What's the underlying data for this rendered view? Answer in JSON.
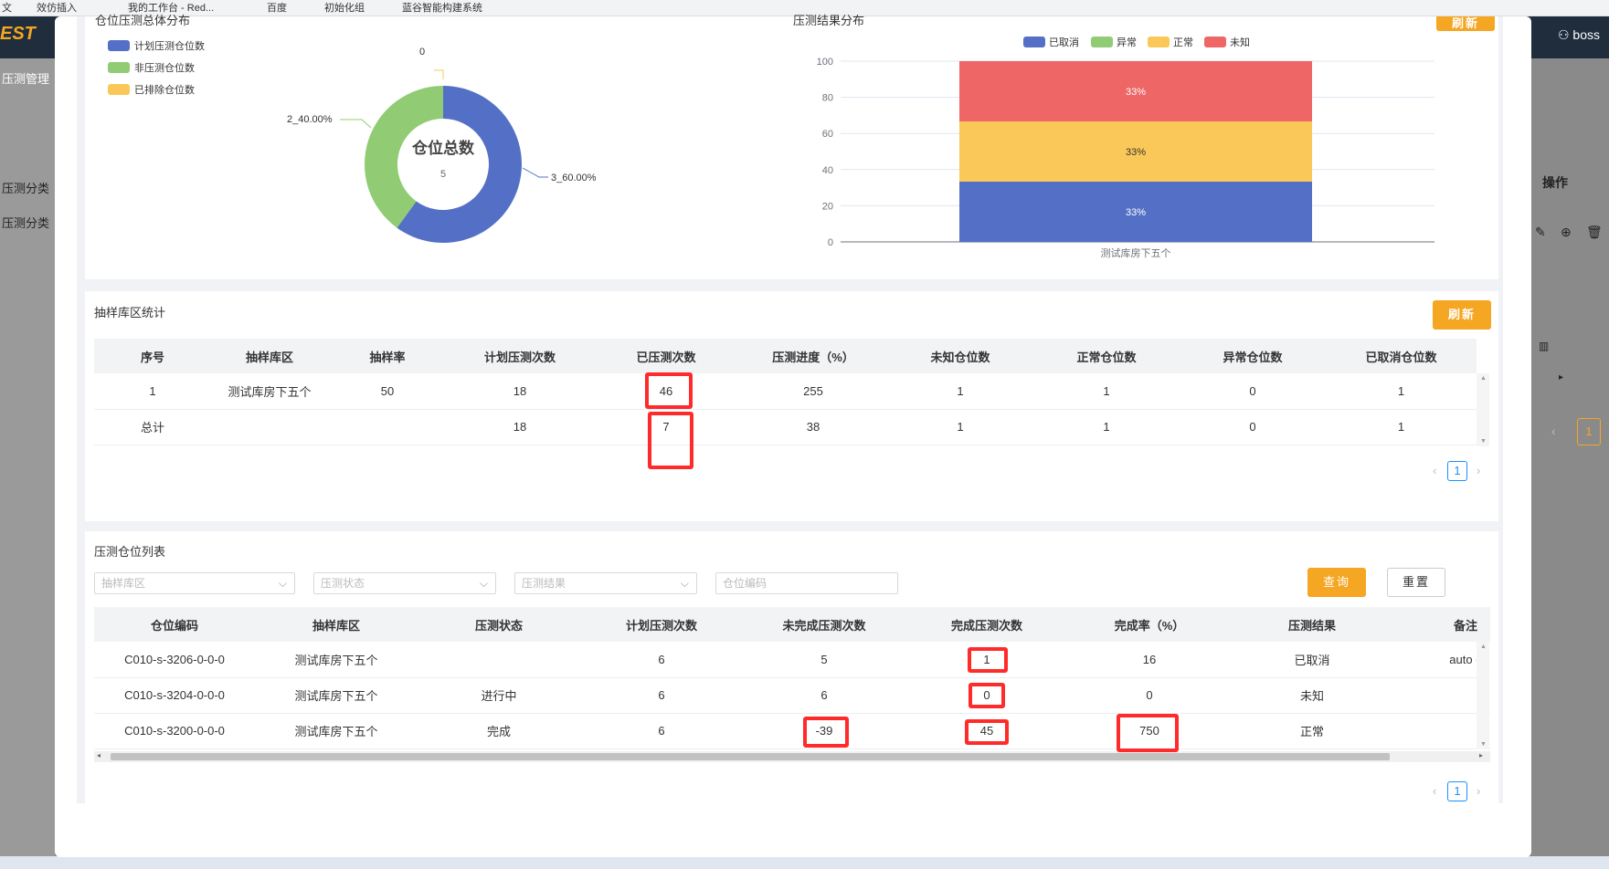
{
  "background": {
    "bookmarks": [
      "文",
      "效仿插入",
      "我的工作台 - Red...",
      "百度",
      "初始化组",
      "蓝谷智能构建系统"
    ],
    "logo": "EST",
    "user": "boss",
    "nav_items": [
      "压测管理",
      "压测分类",
      "压测分类"
    ],
    "operation_label": "操作",
    "pager_current": "1"
  },
  "donut": {
    "title": "仓位压测总体分布",
    "legend": [
      {
        "label": "计划压测仓位数",
        "color": "#5470c6"
      },
      {
        "label": "非压测仓位数",
        "color": "#91cc75"
      },
      {
        "label": "已排除仓位数",
        "color": "#fac858"
      }
    ],
    "center_title": "仓位总数",
    "center_value": "5",
    "labels": {
      "excluded": "0",
      "non_test": "2_40.00%",
      "planned": "3_60.00%"
    },
    "values": {
      "planned": 3,
      "non_test": 2,
      "excluded": 0
    }
  },
  "chart_data": {
    "type": "bar",
    "title": "压测结果分布",
    "categories": [
      "测试库房下五个"
    ],
    "series": [
      {
        "name": "已取消",
        "values": [
          33
        ],
        "label": "33%",
        "color": "#5470c6"
      },
      {
        "name": "异常",
        "values": [
          0
        ],
        "label": "",
        "color": "#91cc75"
      },
      {
        "name": "正常",
        "values": [
          33
        ],
        "label": "33%",
        "color": "#fac858"
      },
      {
        "name": "未知",
        "values": [
          33
        ],
        "label": "33%",
        "color": "#ee6666"
      }
    ],
    "yticks": [
      "100",
      "80",
      "60",
      "40",
      "20",
      "0"
    ],
    "ylim": [
      0,
      100
    ],
    "stacked": true,
    "legend_position": "top"
  },
  "top_refresh_label": "刷新",
  "sampling": {
    "title": "抽样库区统计",
    "refresh_label": "刷新",
    "columns": [
      "序号",
      "抽样库区",
      "抽样率",
      "计划压测次数",
      "已压测次数",
      "压测进度（%）",
      "未知仓位数",
      "正常仓位数",
      "异常仓位数",
      "已取消仓位数"
    ],
    "rows": [
      [
        "1",
        "测试库房下五个",
        "50",
        "18",
        "46",
        "255",
        "1",
        "1",
        "0",
        "1"
      ],
      [
        "总计",
        "",
        "",
        "18",
        "7",
        "38",
        "1",
        "1",
        "0",
        "1"
      ]
    ],
    "page": "1"
  },
  "positions": {
    "title": "压测仓位列表",
    "filters": {
      "zone_placeholder": "抽样库区",
      "status_placeholder": "压测状态",
      "result_placeholder": "压测结果",
      "code_placeholder": "仓位编码"
    },
    "query_label": "查询",
    "reset_label": "重置",
    "columns": [
      "仓位编码",
      "抽样库区",
      "压测状态",
      "计划压测次数",
      "未完成压测次数",
      "完成压测次数",
      "完成率（%）",
      "压测结果",
      "备注"
    ],
    "rows": [
      [
        "C010-s-3206-0-0-0",
        "测试库房下五个",
        "",
        "6",
        "5",
        "1",
        "16",
        "已取消",
        "auto c"
      ],
      [
        "C010-s-3204-0-0-0",
        "测试库房下五个",
        "进行中",
        "6",
        "6",
        "0",
        "0",
        "未知",
        ""
      ],
      [
        "C010-s-3200-0-0-0",
        "测试库房下五个",
        "完成",
        "6",
        "-39",
        "45",
        "750",
        "正常",
        ""
      ]
    ],
    "page": "1"
  },
  "colors": {
    "accent": "#f5a623",
    "highlight": "#ff2a2a",
    "pager": "#1890ff"
  }
}
